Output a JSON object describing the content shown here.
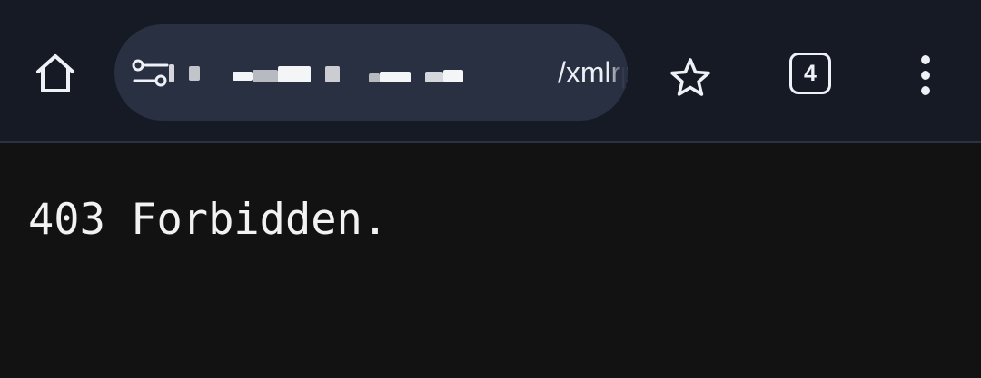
{
  "toolbar": {
    "home_icon": "home-icon",
    "site_info_icon": "tune-icon",
    "url_visible": "/xmlrpc.php",
    "bookmark_icon": "star-outline-icon",
    "tab_count": "4",
    "menu_icon": "more-vertical-icon"
  },
  "page": {
    "body_text": "403 Forbidden."
  },
  "colors": {
    "toolbar_bg": "#151a25",
    "omnibox_bg": "#283042",
    "page_bg": "#121212",
    "text": "#f2f2f2"
  }
}
